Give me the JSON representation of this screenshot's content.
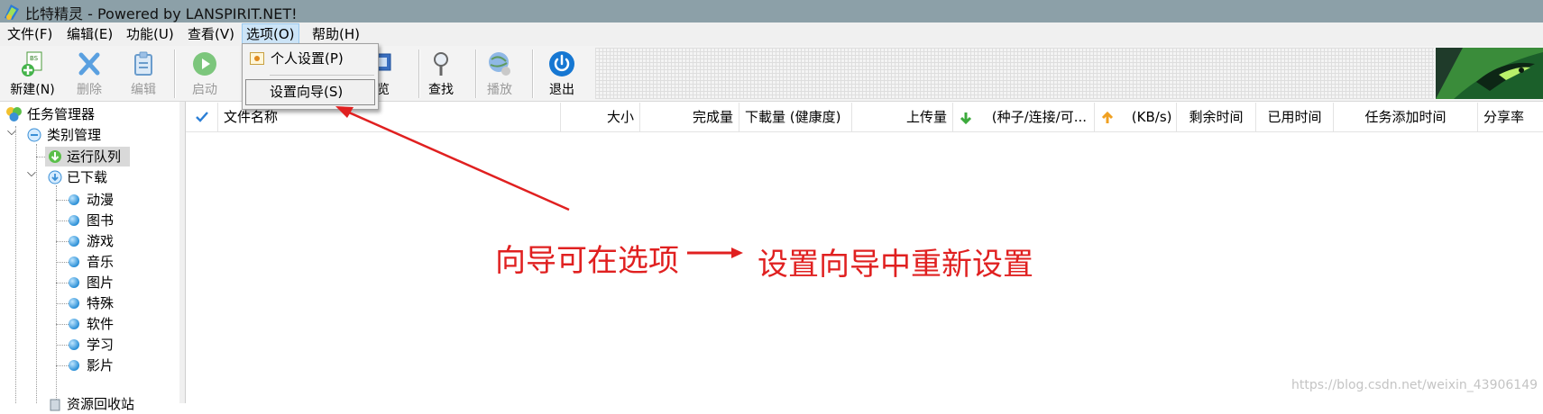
{
  "window": {
    "title": "比特精灵 - Powered by LANSPIRIT.NET!"
  },
  "menubar": {
    "items": [
      {
        "label": "文件(F)"
      },
      {
        "label": "编辑(E)"
      },
      {
        "label": "功能(U)"
      },
      {
        "label": "查看(V)"
      },
      {
        "label": "选项(O)"
      },
      {
        "label": "帮助(H)"
      }
    ]
  },
  "dropdown": {
    "items": [
      {
        "label": "个人设置(P)"
      },
      {
        "label": "设置向导(S)"
      }
    ]
  },
  "toolbar": {
    "buttons": [
      {
        "label": "新建(N)",
        "enabled": true
      },
      {
        "label": "删除",
        "enabled": false
      },
      {
        "label": "编辑",
        "enabled": false
      },
      {
        "label": "启动",
        "enabled": false
      },
      {
        "label": "览",
        "enabled": true
      },
      {
        "label": "查找",
        "enabled": true
      },
      {
        "label": "播放",
        "enabled": false
      },
      {
        "label": "退出",
        "enabled": true
      }
    ]
  },
  "sidebar": {
    "root": "任务管理器",
    "category_manager": "类别管理",
    "running_queue": "运行队列",
    "downloaded": "已下载",
    "categories": [
      "动漫",
      "图书",
      "游戏",
      "音乐",
      "图片",
      "特殊",
      "软件",
      "学习",
      "影片"
    ],
    "last_partial": "资源回收站"
  },
  "list": {
    "columns": [
      {
        "label": "文件名称"
      },
      {
        "label": "大小"
      },
      {
        "label": "完成量"
      },
      {
        "label": "下載量 (健康度)"
      },
      {
        "label": "上传量"
      },
      {
        "label": "(种子/连接/可..."
      },
      {
        "label": "(KB/s)"
      },
      {
        "label": "剩余时间"
      },
      {
        "label": "已用时间"
      },
      {
        "label": "任务添加时间"
      },
      {
        "label": "分享率"
      }
    ]
  },
  "annotation": {
    "left_text": "向导可在选项",
    "right_text": "设置向导中重新设置",
    "color": "#e02020"
  },
  "watermark": "https://blog.csdn.net/weixin_43906149"
}
